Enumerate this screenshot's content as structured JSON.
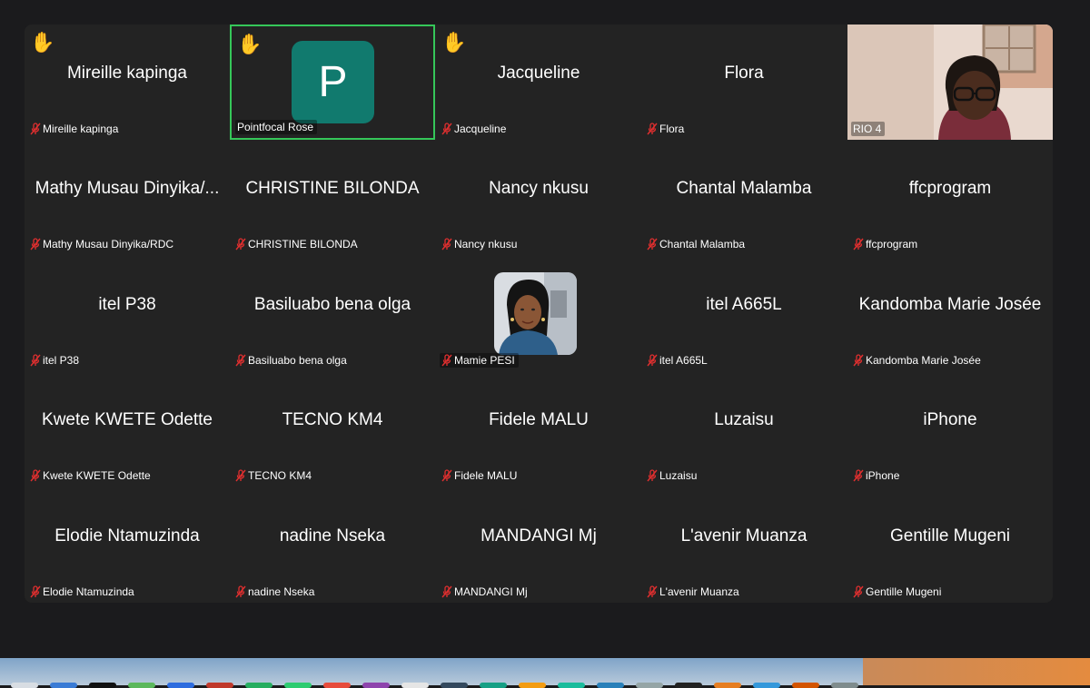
{
  "colors": {
    "window_bg": "#1b1b1d",
    "tile_bg": "#232323",
    "active_speaker_border": "#35c759",
    "avatar_p_bg": "#117a6e",
    "muted_mic_red": "#e02f2f"
  },
  "participants": [
    {
      "display": "Mireille kapinga",
      "label": "Mireille kapinga",
      "hand_raised": true,
      "muted": true,
      "view": "name"
    },
    {
      "display": "P",
      "label": "Pointfocal Rose",
      "hand_raised": true,
      "muted": false,
      "view": "initial",
      "active_speaker": true
    },
    {
      "display": "Jacqueline",
      "label": "Jacqueline",
      "hand_raised": true,
      "muted": true,
      "view": "name"
    },
    {
      "display": "Flora",
      "label": "Flora",
      "hand_raised": false,
      "muted": true,
      "view": "name"
    },
    {
      "display": "",
      "label": "RIO 4",
      "hand_raised": false,
      "muted": false,
      "view": "video"
    },
    {
      "display": "Mathy Musau Dinyika/...",
      "label": "Mathy Musau Dinyika/RDC",
      "hand_raised": false,
      "muted": true,
      "view": "name"
    },
    {
      "display": "CHRISTINE BILONDA",
      "label": "CHRISTINE BILONDA",
      "hand_raised": false,
      "muted": true,
      "view": "name"
    },
    {
      "display": "Nancy nkusu",
      "label": "Nancy nkusu",
      "hand_raised": false,
      "muted": true,
      "view": "name"
    },
    {
      "display": "Chantal Malamba",
      "label": "Chantal Malamba",
      "hand_raised": false,
      "muted": true,
      "view": "name"
    },
    {
      "display": "ffcprogram",
      "label": "ffcprogram",
      "hand_raised": false,
      "muted": true,
      "view": "name"
    },
    {
      "display": "itel P38",
      "label": "itel P38",
      "hand_raised": false,
      "muted": true,
      "view": "name"
    },
    {
      "display": "Basiluabo bena olga",
      "label": "Basiluabo bena olga",
      "hand_raised": false,
      "muted": true,
      "view": "name"
    },
    {
      "display": "",
      "label": "Mamie PESI",
      "hand_raised": false,
      "muted": true,
      "view": "photo"
    },
    {
      "display": "itel A665L",
      "label": "itel A665L",
      "hand_raised": false,
      "muted": true,
      "view": "name"
    },
    {
      "display": "Kandomba Marie Josée",
      "label": "Kandomba Marie Josée",
      "hand_raised": false,
      "muted": true,
      "view": "name"
    },
    {
      "display": "Kwete KWETE Odette",
      "label": "Kwete KWETE Odette",
      "hand_raised": false,
      "muted": true,
      "view": "name"
    },
    {
      "display": "TECNO KM4",
      "label": "TECNO KM4",
      "hand_raised": false,
      "muted": true,
      "view": "name"
    },
    {
      "display": "Fidele MALU",
      "label": "Fidele MALU",
      "hand_raised": false,
      "muted": true,
      "view": "name"
    },
    {
      "display": "Luzaisu",
      "label": "Luzaisu",
      "hand_raised": false,
      "muted": true,
      "view": "name"
    },
    {
      "display": "iPhone",
      "label": "iPhone",
      "hand_raised": false,
      "muted": true,
      "view": "name"
    },
    {
      "display": "Elodie Ntamuzinda",
      "label": "Elodie Ntamuzinda",
      "hand_raised": false,
      "muted": true,
      "view": "name"
    },
    {
      "display": "nadine Nseka",
      "label": "nadine Nseka",
      "hand_raised": false,
      "muted": true,
      "view": "name"
    },
    {
      "display": "MANDANGI Mj",
      "label": "MANDANGI Mj",
      "hand_raised": false,
      "muted": true,
      "view": "name"
    },
    {
      "display": "L'avenir Muanza",
      "label": "L'avenir Muanza",
      "hand_raised": false,
      "muted": true,
      "view": "name"
    },
    {
      "display": "Gentille Mugeni",
      "label": "Gentille Mugeni",
      "hand_raised": false,
      "muted": true,
      "view": "name"
    }
  ],
  "icons": {
    "hand": "raised-hand-icon",
    "mic": "muted-mic-icon"
  }
}
